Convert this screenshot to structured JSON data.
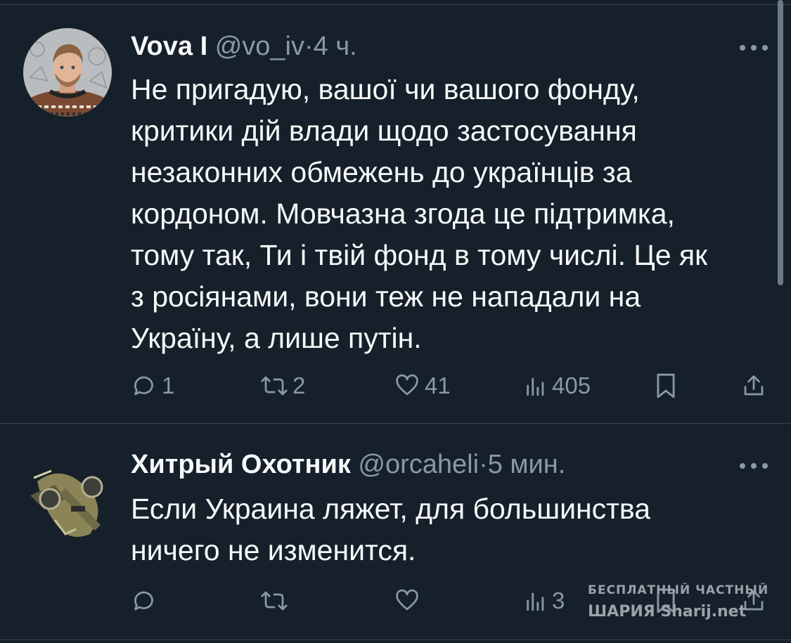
{
  "tweets": [
    {
      "name": "Vova I",
      "handle": "@vo_iv",
      "separator": "·",
      "time": "4 ч.",
      "text": "Не пригадую, вашої чи вашого фонду,\nкритики дій влади щодо застосування\nнезаконних обмежень до українців за\nкордоном. Мовчазна згода це підтримка,\nтому так, Ти і твій фонд в тому числі. Це як\nз росіянами, вони теж не нападали на\nУкраїну, а лише путін.",
      "replies": "1",
      "reposts": "2",
      "likes": "41",
      "views": "405"
    },
    {
      "name": "Хитрый Охотник",
      "handle": "@orcaheli",
      "separator": "·",
      "time": "5 мин.",
      "text": "Если Украина ляжет, для большинства\nничего не изменится.",
      "replies": "",
      "reposts": "",
      "likes": "",
      "views": "3"
    }
  ],
  "icons": {
    "more": "more-icon",
    "reply": "reply-icon",
    "repost": "repost-icon",
    "like": "heart-icon",
    "views": "views-icon",
    "bookmark": "bookmark-icon",
    "share": "share-icon"
  },
  "watermark": {
    "line1": "БЕСПЛАТНЫЙ ЧАСТНЫЙ",
    "line2": "ШАРИЯ Sharij.net"
  },
  "colors": {
    "background": "#15202b",
    "text": "#f7f9f9",
    "secondary": "#8b98a5",
    "divider": "#38444d"
  }
}
